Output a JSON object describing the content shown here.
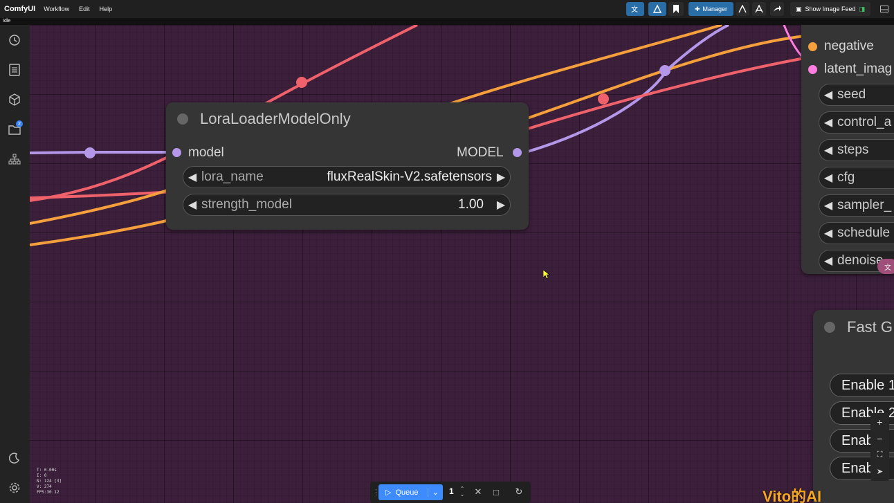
{
  "app": {
    "name": "ComfyUI"
  },
  "menu": [
    "Workflow",
    "Edit",
    "Help"
  ],
  "toolbar": {
    "manager_label": "Manager",
    "image_feed_label": "Show Image Feed"
  },
  "status": "Idle",
  "sidebar": {
    "queue_badge": "2"
  },
  "stats": [
    "T: 0.00s",
    "I: 0",
    "N: 124 [3]",
    "V: 274",
    "FPS:30.12"
  ],
  "nodes": {
    "lora": {
      "title": "LoraLoaderModelOnly",
      "input_label": "model",
      "output_label": "MODEL",
      "widgets": [
        {
          "name": "lora_name",
          "value": "fluxRealSkin-V2.safetensors"
        },
        {
          "name": "strength_model",
          "value": "1.00"
        }
      ]
    },
    "ksampler": {
      "inputs": [
        "negative",
        "latent_imag"
      ],
      "widgets": [
        "seed",
        "control_a",
        "steps",
        "cfg",
        "sampler_",
        "schedule",
        "denoise"
      ]
    },
    "fastgroups": {
      "title": "Fast G",
      "buttons": [
        "Enable 1",
        "Enable 2",
        "Enab",
        "Enab"
      ]
    }
  },
  "queue": {
    "label": "Queue",
    "count": "1"
  },
  "watermark": "Vito的AI"
}
